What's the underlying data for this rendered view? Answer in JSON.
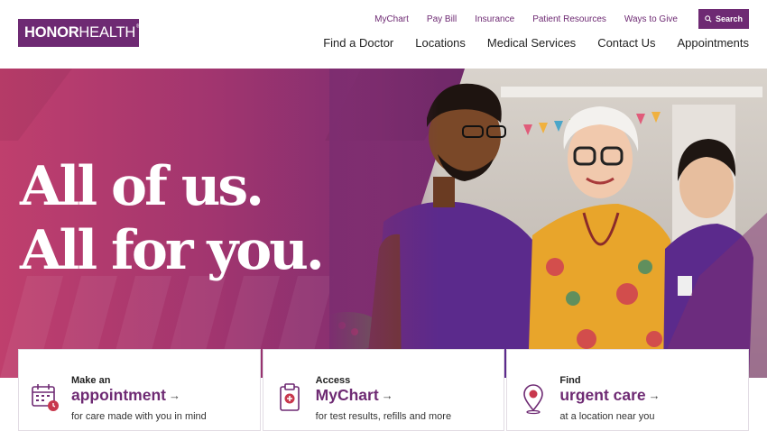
{
  "logo": {
    "honor": "HONOR",
    "health": "HEALTH",
    "reg": "®"
  },
  "utility_nav": [
    "MyChart",
    "Pay Bill",
    "Insurance",
    "Patient Resources",
    "Ways to Give"
  ],
  "search": {
    "label": "Search",
    "icon": "search-icon"
  },
  "main_nav": [
    "Find a Doctor",
    "Locations",
    "Medical Services",
    "Contact Us",
    "Appointments"
  ],
  "hero": {
    "line1": "All of us.",
    "line2": "All for you."
  },
  "cards": [
    {
      "small": "Make an",
      "big": "appointment",
      "arrow": "→",
      "desc": "for care made with you in mind",
      "icon": "calendar-icon"
    },
    {
      "small": "Access",
      "big": "MyChart",
      "arrow": "→",
      "desc": "for test results, refills and more",
      "icon": "clipboard-icon"
    },
    {
      "small": "Find",
      "big": "urgent care",
      "arrow": "→",
      "desc": "at a location near you",
      "icon": "location-pin-icon"
    }
  ],
  "colors": {
    "brand": "#6e2a73",
    "hero_left": "#bf3f6d",
    "hero_right": "#5c266d",
    "accent_red": "#c8384d"
  }
}
